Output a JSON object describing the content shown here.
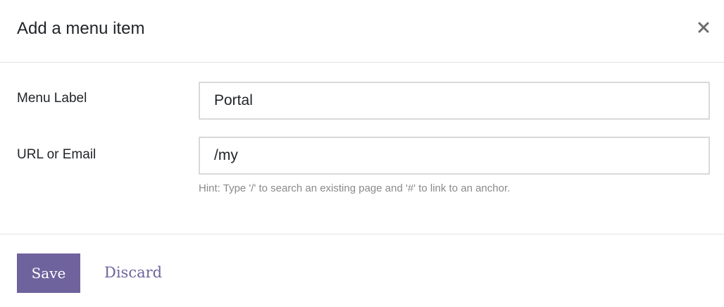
{
  "dialog": {
    "title": "Add a menu item",
    "close_icon": "close-icon"
  },
  "form": {
    "menu_label": {
      "label": "Menu Label",
      "value": "Portal"
    },
    "url": {
      "label": "URL or Email",
      "value": "/my"
    },
    "hint": "Hint: Type '/' to search an existing page and '#' to link to an anchor."
  },
  "footer": {
    "save_label": "Save",
    "discard_label": "Discard"
  },
  "colors": {
    "accent": "#6f639d",
    "border": "#dee2e6",
    "hint": "#8a8a8a"
  }
}
